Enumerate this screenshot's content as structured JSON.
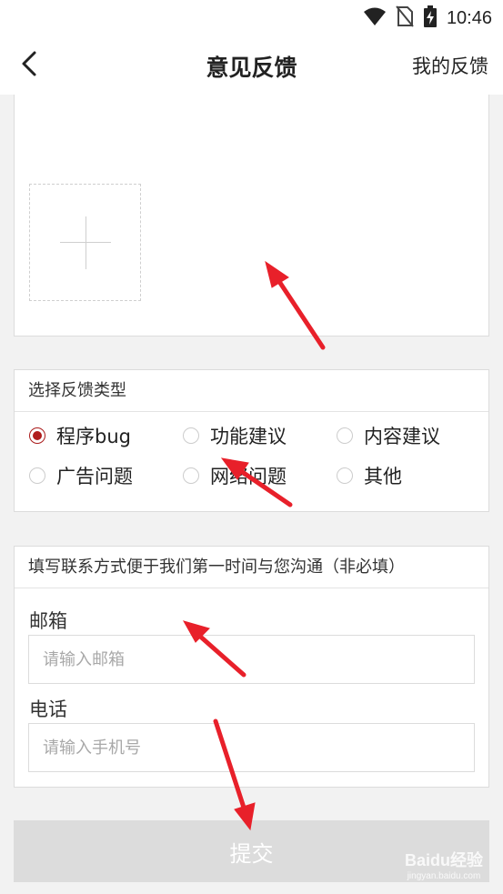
{
  "status_bar": {
    "time": "10:46",
    "icons": [
      "wifi-icon",
      "no-sim-icon",
      "battery-charging-icon"
    ]
  },
  "header": {
    "back_icon": "chevron-left-icon",
    "title": "意见反馈",
    "my_feedback_label": "我的反馈"
  },
  "image_upload": {
    "add_icon": "plus-icon"
  },
  "feedback_type": {
    "header": "选择反馈类型",
    "selected": "程序bug",
    "options": [
      {
        "label": "程序bug",
        "checked": true
      },
      {
        "label": "功能建议",
        "checked": false
      },
      {
        "label": "内容建议",
        "checked": false
      },
      {
        "label": "广告问题",
        "checked": false
      },
      {
        "label": "网络问题",
        "checked": false
      },
      {
        "label": "其他",
        "checked": false
      }
    ]
  },
  "contact": {
    "header": "填写联系方式便于我们第一时间与您沟通（非必填）",
    "email_label": "邮箱",
    "email_value": "",
    "email_placeholder": "请输入邮箱",
    "phone_label": "电话",
    "phone_value": "",
    "phone_placeholder": "请输入手机号"
  },
  "submit_label": "提交",
  "watermark": {
    "logo": "Baidu经验",
    "sub": "jingyan.baidu.com"
  },
  "colors": {
    "accent_radio": "#b01c1c",
    "annotation_arrow": "#e8202a",
    "submit_disabled": "#dcdcdc",
    "background": "#f2f2f2"
  }
}
